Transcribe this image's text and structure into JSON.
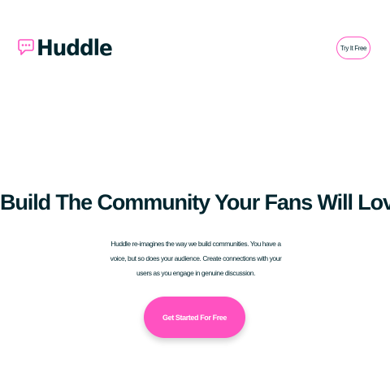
{
  "brand": {
    "name": "Huddle",
    "logo_icon": "speech-bubble-icon",
    "accent_color": "#ff52c1",
    "text_color": "#00252e"
  },
  "header": {
    "cta_label": "Try It Free"
  },
  "hero": {
    "title": "Build The Community Your Fans Will Love",
    "description": "Huddle re-imagines the way we build communities. You have a voice, but so does your audience. Create connections with your users as you engage in genuine discussion.",
    "cta_label": "Get Started For Free"
  }
}
